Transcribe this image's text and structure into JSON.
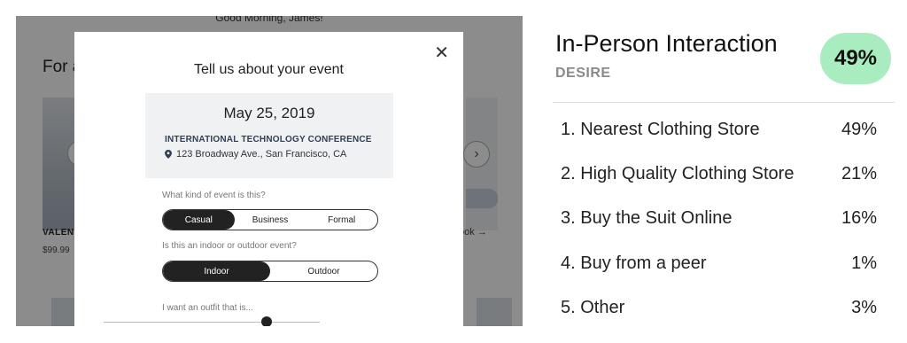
{
  "screenshot": {
    "greeting": "Good Morning, James!",
    "section_title": "For a",
    "product_label": "VALENT",
    "product_price": "$99.99",
    "look_link": "ook",
    "modal": {
      "close": "✕",
      "title": "Tell us about your event",
      "event": {
        "date": "May 25, 2019",
        "name": "INTERNATIONAL TECHNOLOGY CONFERENCE",
        "address": "123 Broadway Ave., San Francisco, CA"
      },
      "question_kind": "What kind of event is this?",
      "kind_options": [
        "Casual",
        "Business",
        "Formal"
      ],
      "kind_selected": "Casual",
      "question_location": "Is this an indoor or outdoor event?",
      "location_options": [
        "Indoor",
        "Outdoor"
      ],
      "location_selected": "Indoor",
      "question_outfit": "I want an outfit that is..."
    }
  },
  "panel": {
    "title": "In-Person Interaction",
    "subtitle": "DESIRE",
    "badge": "49%",
    "badge_color": "#a8ecc0",
    "rows": [
      {
        "label": "1. Nearest Clothing Store",
        "pct": "49%"
      },
      {
        "label": "2. High Quality Clothing Store",
        "pct": "21%"
      },
      {
        "label": "3. Buy the Suit Online",
        "pct": "16%"
      },
      {
        "label": "4. Buy from a peer",
        "pct": "1%"
      },
      {
        "label": "5. Other",
        "pct": "3%"
      }
    ]
  }
}
